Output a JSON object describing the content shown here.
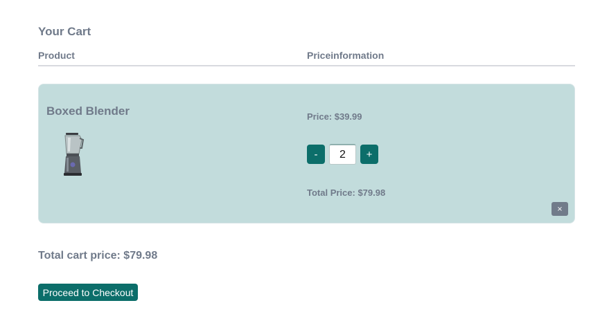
{
  "cart": {
    "title": "Your Cart",
    "columns": {
      "product": "Product",
      "price_info": "Priceinformation"
    }
  },
  "items": [
    {
      "name": "Boxed Blender",
      "image_icon": "blender-icon",
      "unit_price": "Price: $39.99",
      "quantity": "2",
      "decrement_label": "-",
      "increment_label": "+",
      "total_price": "Total Price: $79.98",
      "remove_label": "×"
    }
  ],
  "summary": {
    "total": "Total cart price: $79.98",
    "checkout_label": "Proceed to Checkout"
  },
  "colors": {
    "accent": "#0c6e6a",
    "item_background": "#c2dcdc",
    "text": "#707a8a",
    "remove_button": "#717b8a"
  }
}
